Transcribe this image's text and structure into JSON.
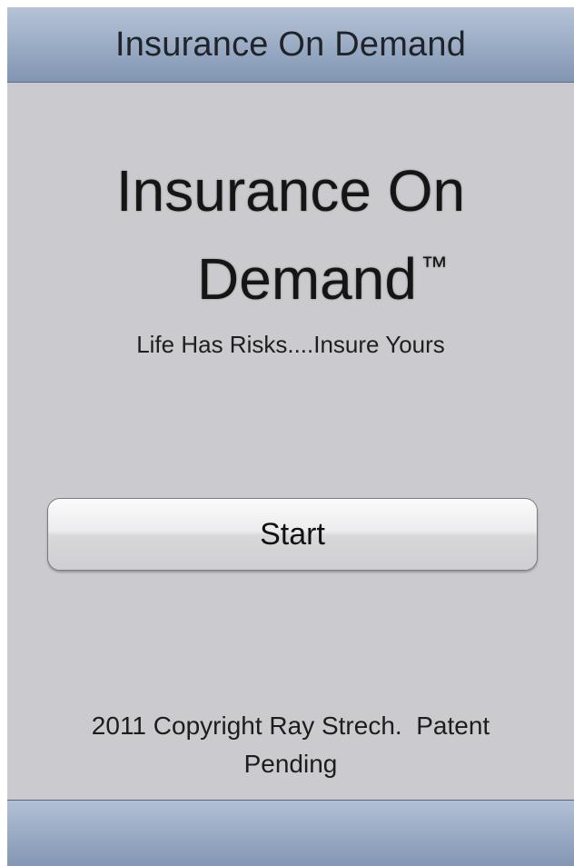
{
  "navbar": {
    "title": "Insurance On Demand"
  },
  "hero": {
    "title_line1": "Insurance On",
    "title_line2": "Demand",
    "trademark": "™",
    "tagline": "Life Has Risks....Insure Yours"
  },
  "start_button": {
    "label": "Start"
  },
  "footer": {
    "copyright_line1": "2011 Copyright Ray Strech.  Patent",
    "copyright_line2": "Pending"
  },
  "colors": {
    "background": "#cbcbcf",
    "navbar": "#9eafc7",
    "text": "#1a1a1a"
  }
}
